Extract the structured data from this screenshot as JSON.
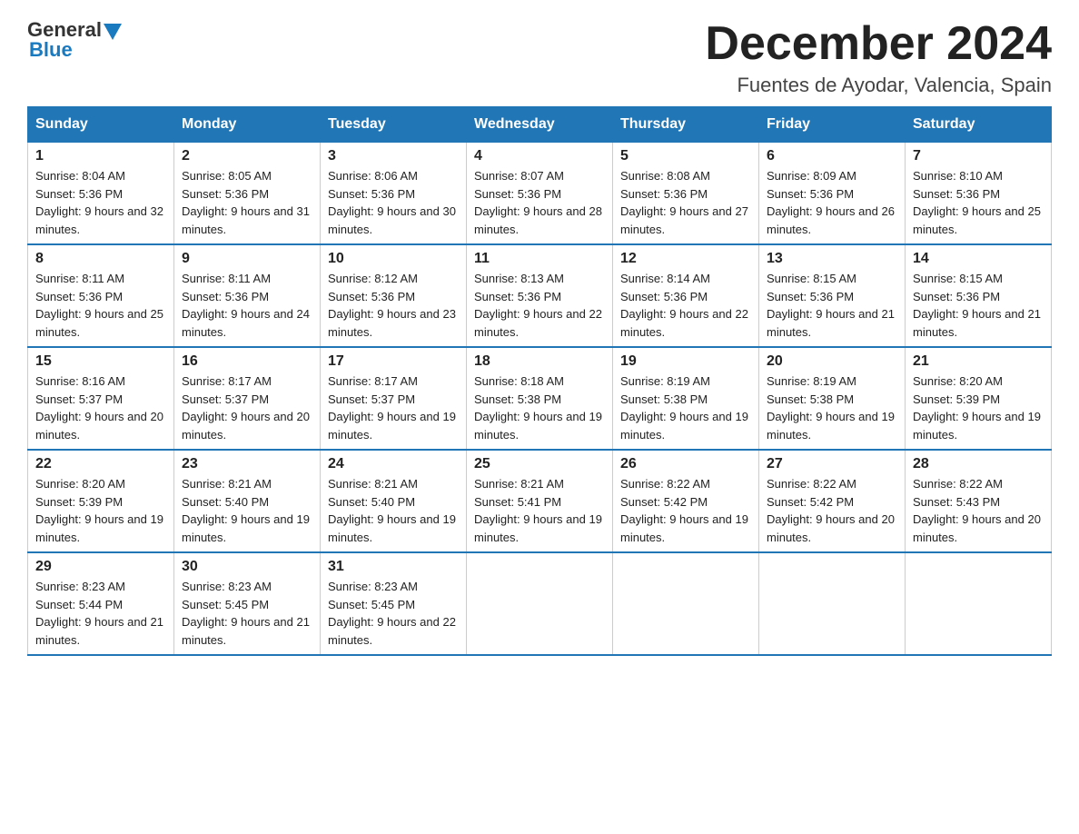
{
  "header": {
    "logo_general": "General",
    "logo_blue": "Blue",
    "month_title": "December 2024",
    "location": "Fuentes de Ayodar, Valencia, Spain"
  },
  "weekdays": [
    "Sunday",
    "Monday",
    "Tuesday",
    "Wednesday",
    "Thursday",
    "Friday",
    "Saturday"
  ],
  "weeks": [
    [
      {
        "day": "1",
        "sunrise": "8:04 AM",
        "sunset": "5:36 PM",
        "daylight": "9 hours and 32 minutes."
      },
      {
        "day": "2",
        "sunrise": "8:05 AM",
        "sunset": "5:36 PM",
        "daylight": "9 hours and 31 minutes."
      },
      {
        "day": "3",
        "sunrise": "8:06 AM",
        "sunset": "5:36 PM",
        "daylight": "9 hours and 30 minutes."
      },
      {
        "day": "4",
        "sunrise": "8:07 AM",
        "sunset": "5:36 PM",
        "daylight": "9 hours and 28 minutes."
      },
      {
        "day": "5",
        "sunrise": "8:08 AM",
        "sunset": "5:36 PM",
        "daylight": "9 hours and 27 minutes."
      },
      {
        "day": "6",
        "sunrise": "8:09 AM",
        "sunset": "5:36 PM",
        "daylight": "9 hours and 26 minutes."
      },
      {
        "day": "7",
        "sunrise": "8:10 AM",
        "sunset": "5:36 PM",
        "daylight": "9 hours and 25 minutes."
      }
    ],
    [
      {
        "day": "8",
        "sunrise": "8:11 AM",
        "sunset": "5:36 PM",
        "daylight": "9 hours and 25 minutes."
      },
      {
        "day": "9",
        "sunrise": "8:11 AM",
        "sunset": "5:36 PM",
        "daylight": "9 hours and 24 minutes."
      },
      {
        "day": "10",
        "sunrise": "8:12 AM",
        "sunset": "5:36 PM",
        "daylight": "9 hours and 23 minutes."
      },
      {
        "day": "11",
        "sunrise": "8:13 AM",
        "sunset": "5:36 PM",
        "daylight": "9 hours and 22 minutes."
      },
      {
        "day": "12",
        "sunrise": "8:14 AM",
        "sunset": "5:36 PM",
        "daylight": "9 hours and 22 minutes."
      },
      {
        "day": "13",
        "sunrise": "8:15 AM",
        "sunset": "5:36 PM",
        "daylight": "9 hours and 21 minutes."
      },
      {
        "day": "14",
        "sunrise": "8:15 AM",
        "sunset": "5:36 PM",
        "daylight": "9 hours and 21 minutes."
      }
    ],
    [
      {
        "day": "15",
        "sunrise": "8:16 AM",
        "sunset": "5:37 PM",
        "daylight": "9 hours and 20 minutes."
      },
      {
        "day": "16",
        "sunrise": "8:17 AM",
        "sunset": "5:37 PM",
        "daylight": "9 hours and 20 minutes."
      },
      {
        "day": "17",
        "sunrise": "8:17 AM",
        "sunset": "5:37 PM",
        "daylight": "9 hours and 19 minutes."
      },
      {
        "day": "18",
        "sunrise": "8:18 AM",
        "sunset": "5:38 PM",
        "daylight": "9 hours and 19 minutes."
      },
      {
        "day": "19",
        "sunrise": "8:19 AM",
        "sunset": "5:38 PM",
        "daylight": "9 hours and 19 minutes."
      },
      {
        "day": "20",
        "sunrise": "8:19 AM",
        "sunset": "5:38 PM",
        "daylight": "9 hours and 19 minutes."
      },
      {
        "day": "21",
        "sunrise": "8:20 AM",
        "sunset": "5:39 PM",
        "daylight": "9 hours and 19 minutes."
      }
    ],
    [
      {
        "day": "22",
        "sunrise": "8:20 AM",
        "sunset": "5:39 PM",
        "daylight": "9 hours and 19 minutes."
      },
      {
        "day": "23",
        "sunrise": "8:21 AM",
        "sunset": "5:40 PM",
        "daylight": "9 hours and 19 minutes."
      },
      {
        "day": "24",
        "sunrise": "8:21 AM",
        "sunset": "5:40 PM",
        "daylight": "9 hours and 19 minutes."
      },
      {
        "day": "25",
        "sunrise": "8:21 AM",
        "sunset": "5:41 PM",
        "daylight": "9 hours and 19 minutes."
      },
      {
        "day": "26",
        "sunrise": "8:22 AM",
        "sunset": "5:42 PM",
        "daylight": "9 hours and 19 minutes."
      },
      {
        "day": "27",
        "sunrise": "8:22 AM",
        "sunset": "5:42 PM",
        "daylight": "9 hours and 20 minutes."
      },
      {
        "day": "28",
        "sunrise": "8:22 AM",
        "sunset": "5:43 PM",
        "daylight": "9 hours and 20 minutes."
      }
    ],
    [
      {
        "day": "29",
        "sunrise": "8:23 AM",
        "sunset": "5:44 PM",
        "daylight": "9 hours and 21 minutes."
      },
      {
        "day": "30",
        "sunrise": "8:23 AM",
        "sunset": "5:45 PM",
        "daylight": "9 hours and 21 minutes."
      },
      {
        "day": "31",
        "sunrise": "8:23 AM",
        "sunset": "5:45 PM",
        "daylight": "9 hours and 22 minutes."
      },
      null,
      null,
      null,
      null
    ]
  ],
  "labels": {
    "sunrise": "Sunrise:",
    "sunset": "Sunset:",
    "daylight": "Daylight:"
  }
}
